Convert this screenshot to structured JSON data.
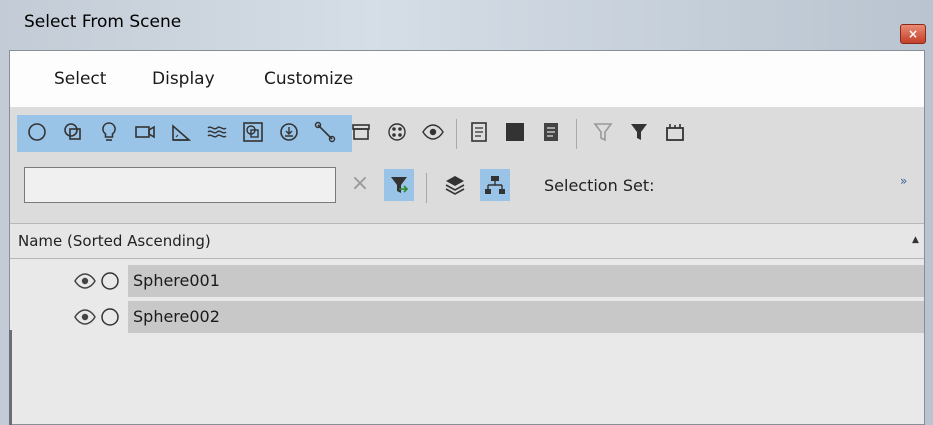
{
  "window": {
    "title": "Select From Scene",
    "close_glyph": "×"
  },
  "menu": {
    "items": [
      "Select",
      "Display",
      "Customize"
    ]
  },
  "toolbar": {
    "icons": [
      "geometry-sphere-icon",
      "shapes-icon",
      "lights-icon",
      "cameras-icon",
      "helpers-icon",
      "space-warps-icon",
      "groups-icon",
      "xrefs-icon",
      "bones-icon",
      "containers-icon",
      "particle-systems-icon",
      "display-hidden-icon",
      "display-children-icon",
      "display-influences-icon",
      "display-dependents-icon",
      "filter-off-icon",
      "filter-icon",
      "select-all-icon"
    ]
  },
  "search": {
    "value": "",
    "clear_glyph": "×"
  },
  "selection_set": {
    "label": "Selection Set:",
    "overflow_glyph": "»"
  },
  "list": {
    "header": "Name (Sorted Ascending)",
    "sort_glyph": "▲",
    "rows": [
      {
        "name": "Sphere001"
      },
      {
        "name": "Sphere002"
      }
    ]
  },
  "colors": {
    "active_toggle": "#99c4e8",
    "row_highlight": "#c8c8c8",
    "close_button": "#c3402a"
  }
}
